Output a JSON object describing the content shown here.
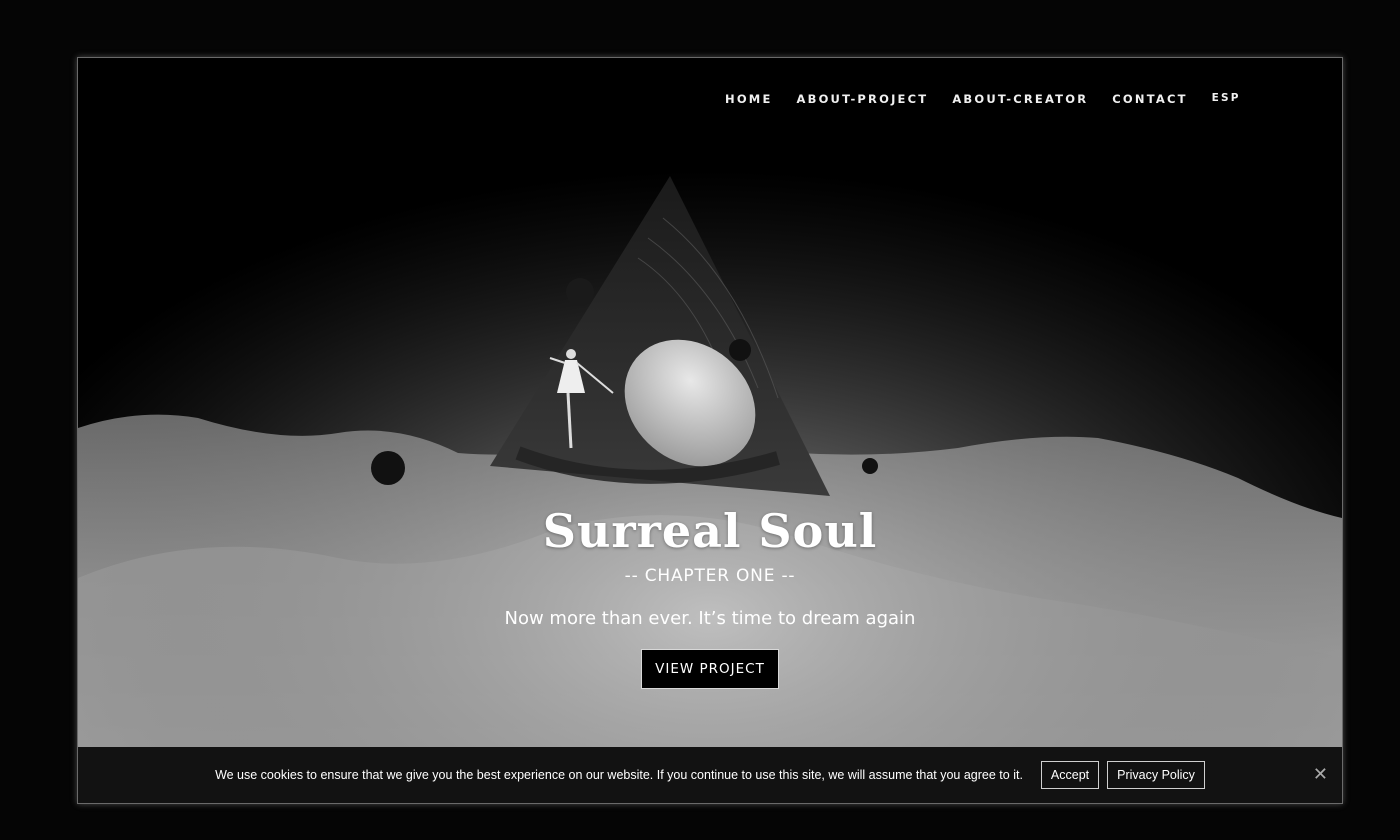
{
  "nav": {
    "items": [
      {
        "label": "HOME"
      },
      {
        "label": "ABOUT-PROJECT"
      },
      {
        "label": "ABOUT-CREATOR"
      },
      {
        "label": "CONTACT"
      },
      {
        "label": "ESP"
      }
    ]
  },
  "hero": {
    "title": "Surreal Soul",
    "chapter": "-- CHAPTER ONE --",
    "tagline": "Now more than ever. It’s time to dream again",
    "cta_label": "VIEW PROJECT",
    "artwork": "triangle-artwork-dancer-moon"
  },
  "cookie_banner": {
    "message": "We use cookies to ensure that we give you the best experience on our website. If you continue to use this site, we will assume that you agree to it.",
    "accept_label": "Accept",
    "privacy_label": "Privacy Policy",
    "close_icon": "close-icon"
  }
}
